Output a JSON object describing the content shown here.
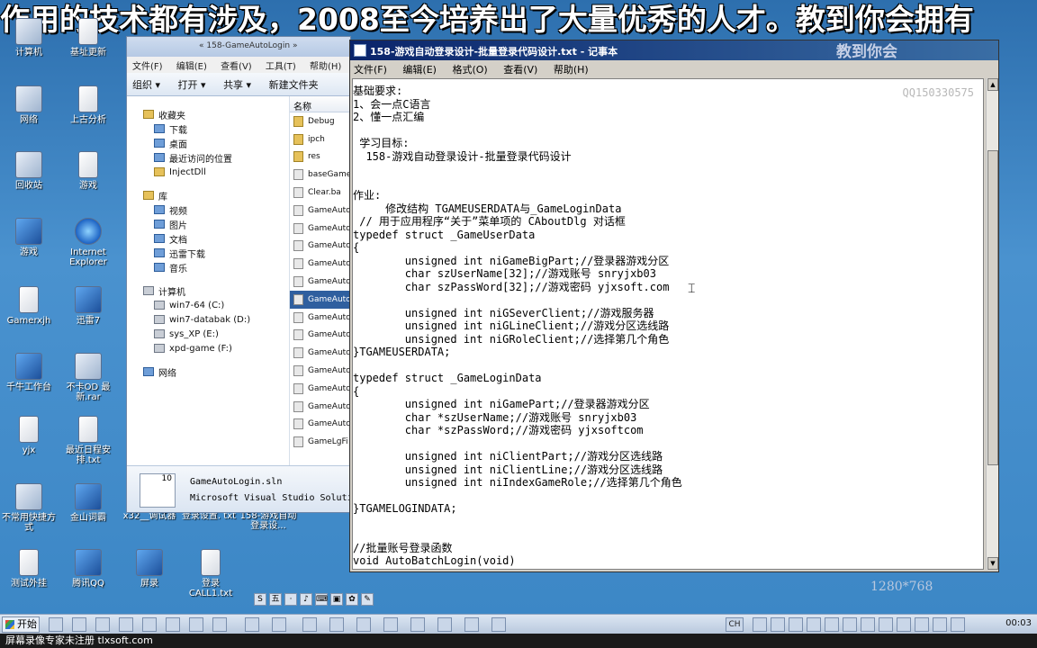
{
  "banner": "作用的技术都有涉及，2008至今培养出了大量优秀的人才。教到你会拥有",
  "desktop_icons": [
    {
      "label": "计算机",
      "icon": "computer-icon"
    },
    {
      "label": "基址更新",
      "icon": "file-icon"
    },
    {
      "label": "网络",
      "icon": "network-icon"
    },
    {
      "label": "上古分析",
      "icon": "file-icon"
    },
    {
      "label": "回收站",
      "icon": "recycle-bin-icon"
    },
    {
      "label": "游戏",
      "icon": "file-icon"
    },
    {
      "label": "游戏",
      "icon": "app-icon"
    },
    {
      "label": "Internet Explorer",
      "icon": "ie-icon"
    },
    {
      "label": "Gamerxjh",
      "icon": "file-icon"
    },
    {
      "label": "迅雷7",
      "icon": "app-icon"
    },
    {
      "label": "千牛工作台",
      "icon": "app-icon"
    },
    {
      "label": "不卡OD 最新.rar",
      "icon": "archive-icon"
    },
    {
      "label": "yjx",
      "icon": "file-icon"
    },
    {
      "label": "最近日程安排.txt",
      "icon": "text-file-icon"
    },
    {
      "label": "不常用快捷方式",
      "icon": "folder-icon"
    },
    {
      "label": "金山词霸",
      "icon": "app-icon"
    },
    {
      "label": "测试外挂",
      "icon": "file-icon"
    },
    {
      "label": "腾讯QQ",
      "icon": "qq-icon"
    },
    {
      "label": "屏录",
      "icon": "app-icon"
    },
    {
      "label": "登录 CALL1.txt",
      "icon": "text-file-icon"
    }
  ],
  "desktop_row_labels": [
    "x32__调试器",
    "登录设置. txt",
    "158-游戏自动登录设..."
  ],
  "explorer": {
    "address": "« 158-GameAutoLogin »",
    "menu": [
      "文件(F)",
      "编辑(E)",
      "查看(V)",
      "工具(T)",
      "帮助(H)"
    ],
    "toolbar": [
      "组织 ▾",
      "打开 ▾",
      "共享 ▾",
      "新建文件夹"
    ],
    "nav_favorites": [
      "收藏夹",
      "下载",
      "桌面",
      "最近访问的位置",
      "InjectDll"
    ],
    "nav_library": [
      "库",
      "视频",
      "图片",
      "文档",
      "迅雷下载",
      "音乐"
    ],
    "nav_computer": [
      "计算机",
      "win7-64 (C:)",
      "win7-databak (D:)",
      "sys_XP (E:)",
      "xpd-game (F:)"
    ],
    "nav_network": "网络",
    "column_header": "名称",
    "files": [
      "Debug",
      "ipch",
      "res",
      "baseGame",
      "Clear.ba",
      "GameAuto",
      "GameAuto",
      "GameAuto",
      "GameAuto",
      "GameAuto",
      "GameAuto",
      "GameAuto",
      "GameAuto",
      "GameAuto",
      "GameAuto",
      "GameAuto",
      "GameAuto",
      "GameAuto",
      "GameLgFi"
    ],
    "selected_index": 10,
    "details_name": "GameAutoLogin.sln",
    "details_type": "Microsoft Visual Studio Solution",
    "details_icon_text": "10"
  },
  "notepad": {
    "title": "158-游戏自动登录设计-批量登录代码设计.txt - 记事本",
    "title_watermark": "教到你会",
    "menu": [
      "文件(F)",
      "编辑(E)",
      "格式(O)",
      "查看(V)",
      "帮助(H)"
    ],
    "qq": "QQ150330575",
    "lines": [
      "基础要求:",
      "1、会一点C语言",
      "2、懂一点汇编",
      "",
      " 学习目标:",
      "  158-游戏自动登录设计-批量登录代码设计",
      "",
      "",
      "作业:",
      "     修改结构 TGAMEUSERDATA与_GameLoginData",
      " // 用于应用程序“关于”菜单项的 CAboutDlg 对话框",
      "typedef struct _GameUserData",
      "{",
      "        unsigned int niGameBigPart;//登录器游戏分区",
      "        char szUserName[32];//游戏账号 snryjxb03",
      "        char szPassWord[32];//游戏密码 yjxsoft.com",
      "",
      "        unsigned int niGSeverClient;//游戏服务器",
      "        unsigned int niGLineClient;//游戏分区选线路",
      "        unsigned int niGRoleClient;//选择第几个角色",
      "}TGAMEUSERDATA;",
      "",
      "typedef struct _GameLoginData",
      "{",
      "        unsigned int niGamePart;//登录器游戏分区",
      "        char *szUserName;//游戏账号 snryjxb03",
      "        char *szPassWord;//游戏密码 yjxsoftcom",
      "",
      "        unsigned int niClientPart;//游戏分区选线路",
      "        unsigned int niClientLine;//游戏分区选线路",
      "        unsigned int niIndexGameRole;//选择第几个角色",
      "",
      "}TGAMELOGINDATA;",
      "",
      "",
      "//批量账号登录函数",
      "void AutoBatchLogin(void)"
    ]
  },
  "resolution": "1280*768",
  "mini_toolbar": [
    "S",
    "五",
    "·",
    "♪",
    "⌨",
    "▣",
    "✿",
    "✎"
  ],
  "taskbar": {
    "start": "开始",
    "clock": "00:03",
    "ime": "CH"
  },
  "footer": "屏幕录像专家未注册 tlxsoft.com"
}
